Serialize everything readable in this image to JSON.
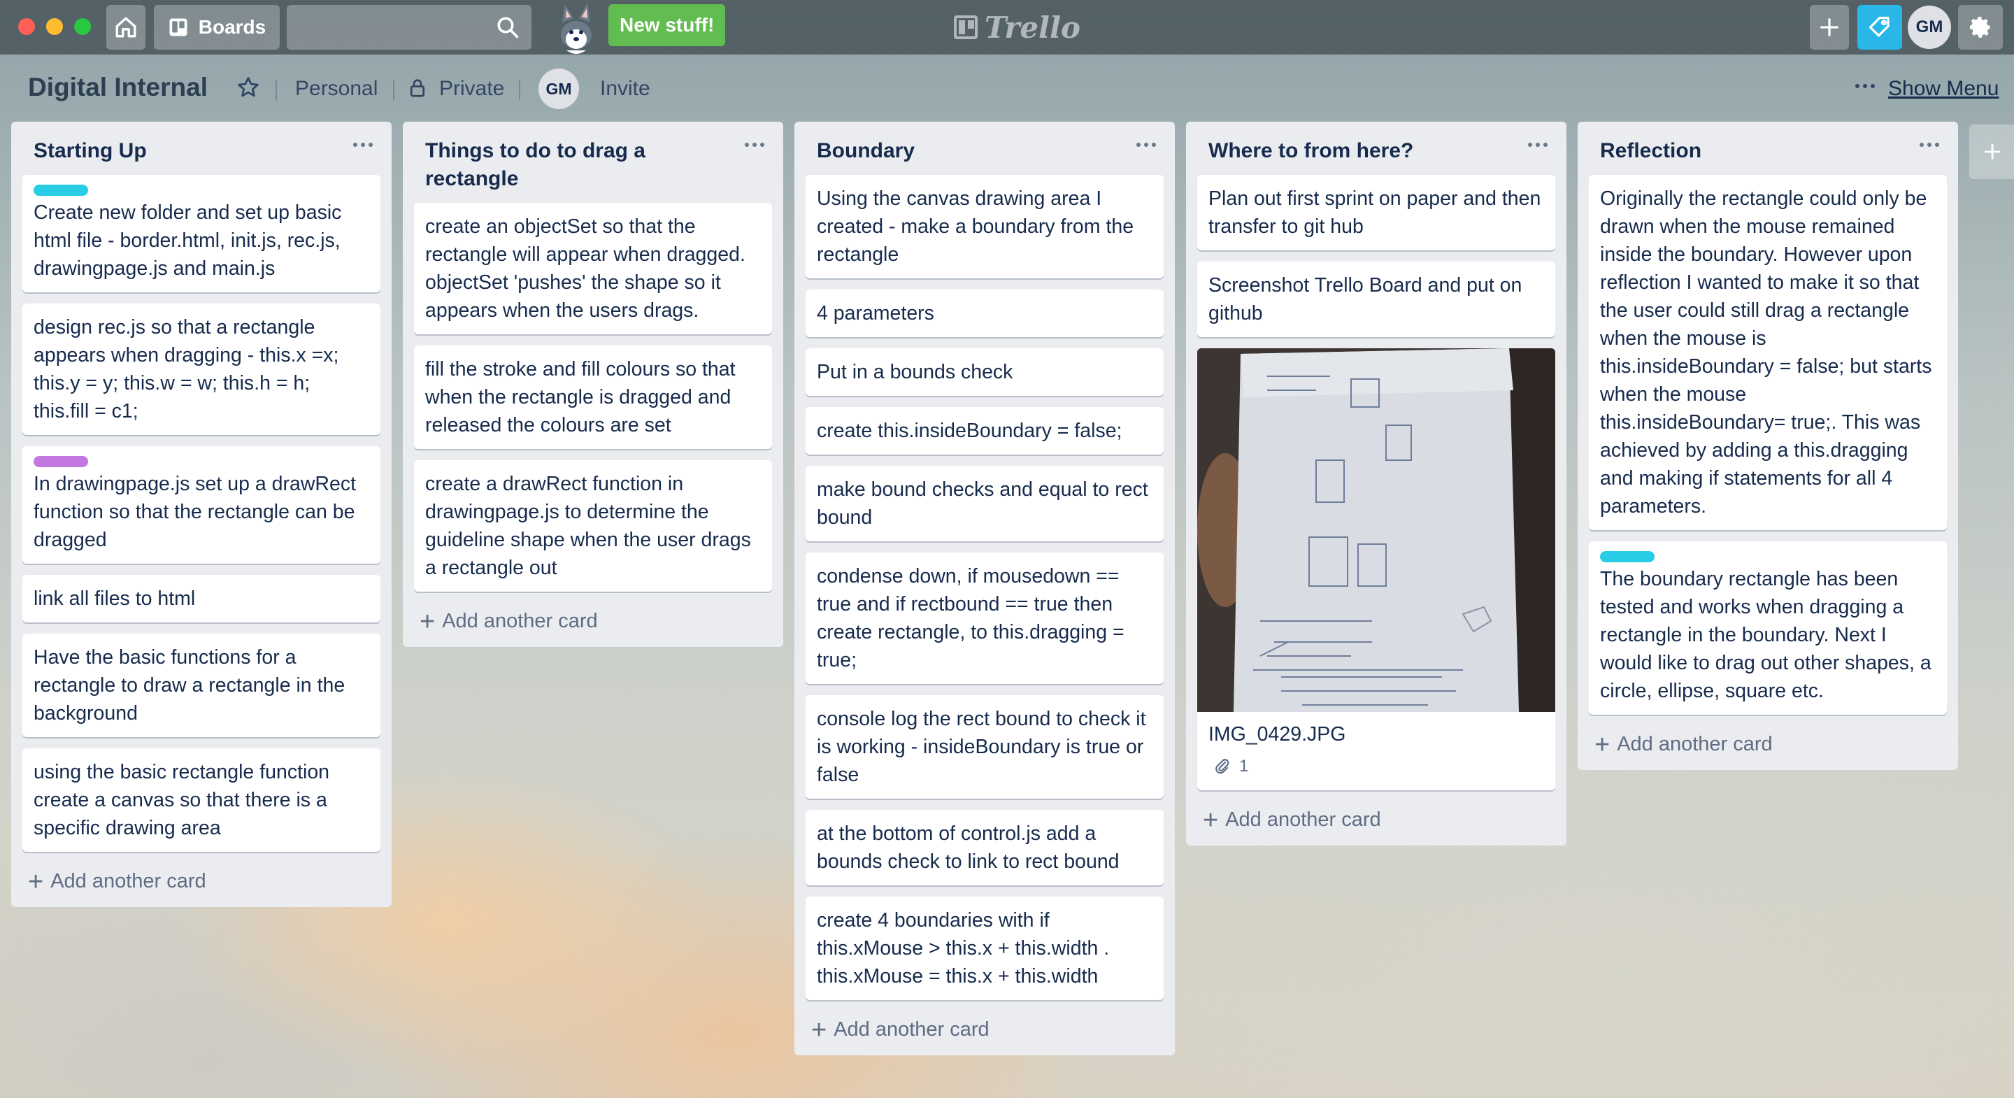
{
  "topbar": {
    "boards_label": "Boards",
    "search_placeholder": "",
    "new_stuff_label": "New stuff!",
    "logo_text": "Trello",
    "user_initials": "GM"
  },
  "board": {
    "title": "Digital Internal",
    "team": "Personal",
    "visibility": "Private",
    "member_initials": "GM",
    "invite_label": "Invite",
    "show_menu_label": "Show Menu"
  },
  "label_colors": {
    "blue": "#29cce5",
    "purple": "#c377e0"
  },
  "add_card_label": "Add another card",
  "lists": [
    {
      "title": "Starting Up",
      "cards": [
        {
          "label": "blue",
          "text": "Create new folder and set up basic html file - border.html, init.js, rec.js, drawingpage.js and main.js"
        },
        {
          "text": "design rec.js so that a rectangle appears when dragging - this.x =x; this.y = y; this.w = w; this.h = h; this.fill = c1;"
        },
        {
          "label": "purple",
          "text": "In drawingpage.js set up a drawRect function so that the rectangle can be dragged"
        },
        {
          "text": "link all files to html"
        },
        {
          "text": "Have the basic functions for a rectangle to draw a rectangle in the background"
        },
        {
          "text": "using the basic rectangle function create a canvas so that there is a specific drawing area"
        }
      ]
    },
    {
      "title": "Things to do to drag a rectangle",
      "cards": [
        {
          "text": "create an objectSet so that the rectangle will appear when dragged. objectSet 'pushes' the shape so it appears when the users drags."
        },
        {
          "text": "fill the stroke and fill colours so that when the rectangle is dragged and released the colours are set"
        },
        {
          "text": "create a drawRect function in drawingpage.js to determine the guideline shape when the user drags a rectangle out"
        }
      ]
    },
    {
      "title": "Boundary",
      "cards": [
        {
          "text": "Using the canvas drawing area I created - make a boundary from the rectangle"
        },
        {
          "text": "4 parameters"
        },
        {
          "text": "Put in a bounds check"
        },
        {
          "text": "create this.insideBoundary = false;"
        },
        {
          "text": "make bound checks and equal to rect bound"
        },
        {
          "text": "condense down, if mousedown == true and if rectbound == true then create rectangle, to this.dragging = true;"
        },
        {
          "text": "console log the rect bound to check it is working - insideBoundary is true or false"
        },
        {
          "text": "at the bottom of control.js add a bounds check to link to rect bound"
        },
        {
          "text": "create 4 boundaries with if this.xMouse > this.x + this.width . this.xMouse = this.x + this.width"
        }
      ]
    },
    {
      "title": "Where to from here?",
      "cards": [
        {
          "text": "Plan out first sprint on paper and then transfer to git hub"
        },
        {
          "text": "Screenshot Trello Board and put on github"
        },
        {
          "image": "paper-sketch",
          "text": "IMG_0429.JPG",
          "attachments": "1"
        }
      ]
    },
    {
      "title": "Reflection",
      "cards": [
        {
          "text": "Originally the rectangle could only be drawn when the mouse remained inside the boundary. However upon reflection I wanted to make it so that the user could still drag a rectangle when the mouse is this.insideBoundary = false; but starts when the mouse this.insideBoundary= true;. This was achieved by adding a this.dragging and making if statements for all 4 parameters."
        },
        {
          "label": "blue",
          "text": "The boundary rectangle has been tested and works when dragging a rectangle in the boundary. Next I would like to drag out other shapes, a circle, ellipse, square etc."
        }
      ]
    }
  ]
}
